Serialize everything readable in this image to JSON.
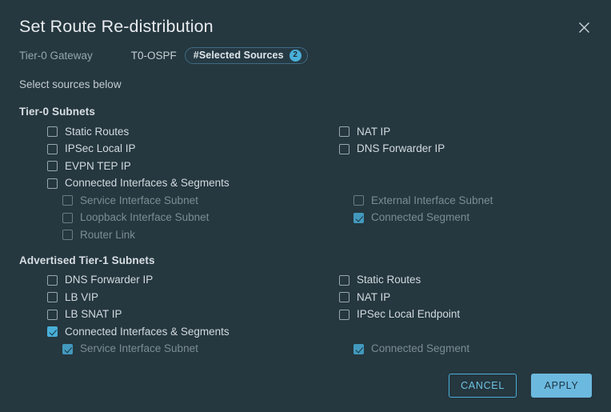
{
  "dialog": {
    "title": "Set Route Re-distribution",
    "close_icon": "close-icon",
    "hint": "Select sources below"
  },
  "breadcrumb": {
    "gateway": "Tier-0 Gateway",
    "name": "T0-OSPF",
    "pill_label": "#Selected Sources",
    "pill_count": "2"
  },
  "colors": {
    "background": "#25373f",
    "accent": "#49afd9",
    "primary_button": "#6cb9e0",
    "text": "#d2dadf",
    "text_dim": "#7b8c95"
  },
  "sections": [
    {
      "title": "Tier-0 Subnets",
      "left": [
        {
          "label": "Static Routes",
          "checked": false,
          "disabled": false,
          "nested": false
        },
        {
          "label": "IPSec Local IP",
          "checked": false,
          "disabled": false,
          "nested": false
        },
        {
          "label": "EVPN TEP IP",
          "checked": false,
          "disabled": false,
          "nested": false
        },
        {
          "label": "Connected Interfaces & Segments",
          "checked": false,
          "disabled": false,
          "nested": false
        },
        {
          "label": "Service Interface Subnet",
          "checked": false,
          "disabled": true,
          "nested": true
        },
        {
          "label": "Loopback Interface Subnet",
          "checked": false,
          "disabled": true,
          "nested": true
        },
        {
          "label": "Router Link",
          "checked": false,
          "disabled": true,
          "nested": true
        }
      ],
      "right": [
        {
          "label": "NAT IP",
          "checked": false,
          "disabled": false,
          "nested": false
        },
        {
          "label": "DNS Forwarder IP",
          "checked": false,
          "disabled": false,
          "nested": false
        },
        {
          "label": "",
          "spacer": true
        },
        {
          "label": "",
          "spacer": true
        },
        {
          "label": "External Interface Subnet",
          "checked": false,
          "disabled": true,
          "nested": true
        },
        {
          "label": "Connected Segment",
          "checked": true,
          "disabled": true,
          "nested": true
        }
      ]
    },
    {
      "title": "Advertised Tier-1 Subnets",
      "left": [
        {
          "label": "DNS Forwarder IP",
          "checked": false,
          "disabled": false,
          "nested": false
        },
        {
          "label": "LB VIP",
          "checked": false,
          "disabled": false,
          "nested": false
        },
        {
          "label": "LB SNAT IP",
          "checked": false,
          "disabled": false,
          "nested": false
        },
        {
          "label": "Connected Interfaces & Segments",
          "checked": true,
          "disabled": false,
          "nested": false
        },
        {
          "label": "Service Interface Subnet",
          "checked": true,
          "disabled": true,
          "nested": true
        }
      ],
      "right": [
        {
          "label": "Static Routes",
          "checked": false,
          "disabled": false,
          "nested": false
        },
        {
          "label": "NAT IP",
          "checked": false,
          "disabled": false,
          "nested": false
        },
        {
          "label": "IPSec Local Endpoint",
          "checked": false,
          "disabled": false,
          "nested": false
        },
        {
          "label": "",
          "spacer": true
        },
        {
          "label": "Connected Segment",
          "checked": true,
          "disabled": true,
          "nested": true
        }
      ]
    }
  ],
  "footer": {
    "cancel_label": "CANCEL",
    "apply_label": "APPLY"
  }
}
